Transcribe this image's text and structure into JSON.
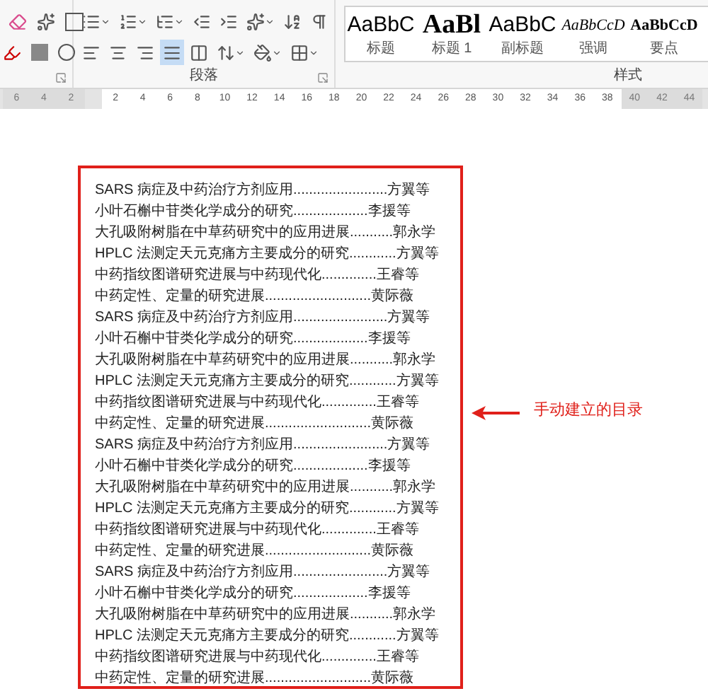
{
  "ribbon": {
    "groups": [
      {
        "kind": "font"
      },
      {
        "kind": "paragraph",
        "label": "段落"
      },
      {
        "kind": "styles",
        "label": "样式"
      }
    ],
    "paragraph_tools": {
      "justify_selected": true
    },
    "styles": [
      {
        "preview": "AaBbC",
        "name": "标题",
        "kind": "sans"
      },
      {
        "preview": "AaBl",
        "name": "标题 1",
        "kind": "heading"
      },
      {
        "preview": "AaBbC",
        "name": "副标题",
        "kind": "sans"
      },
      {
        "preview": "AaBbCcD",
        "name": "强调",
        "kind": "italic"
      },
      {
        "preview": "AaBbCcD",
        "name": "要点",
        "kind": "bold"
      }
    ]
  },
  "ruler": [
    {
      "label": "6",
      "margin": true
    },
    {
      "label": "4",
      "margin": true
    },
    {
      "label": "2",
      "margin": true
    },
    {
      "label": "2",
      "margin": false
    },
    {
      "label": "4",
      "margin": false
    },
    {
      "label": "6",
      "margin": false
    },
    {
      "label": "8",
      "margin": false
    },
    {
      "label": "10",
      "margin": false
    },
    {
      "label": "12",
      "margin": false
    },
    {
      "label": "14",
      "margin": false
    },
    {
      "label": "16",
      "margin": false
    },
    {
      "label": "18",
      "margin": false
    },
    {
      "label": "20",
      "margin": false
    },
    {
      "label": "22",
      "margin": false
    },
    {
      "label": "24",
      "margin": false
    },
    {
      "label": "26",
      "margin": false
    },
    {
      "label": "28",
      "margin": false
    },
    {
      "label": "30",
      "margin": false
    },
    {
      "label": "32",
      "margin": false
    },
    {
      "label": "34",
      "margin": false
    },
    {
      "label": "36",
      "margin": false
    },
    {
      "label": "38",
      "margin": false
    },
    {
      "label": "40",
      "margin": true
    },
    {
      "label": "42",
      "margin": true
    },
    {
      "label": "44",
      "margin": true
    }
  ],
  "toc": [
    {
      "title": "SARS 病症及中药治疗方剂应用",
      "leader": "........................",
      "author": "方翼等"
    },
    {
      "title": "小叶石槲中苷类化学成分的研究",
      "leader": "...................",
      "author": "李援等"
    },
    {
      "title": "大孔吸附树脂在中草药研究中的应用进展",
      "leader": "...........",
      "author": "郭永学"
    },
    {
      "title": "HPLC 法测定天元克痛方主要成分的研究",
      "leader": "............",
      "author": "方翼等"
    },
    {
      "title": "中药指纹图谱研究进展与中药现代化",
      "leader": "..............",
      "author": "王睿等"
    },
    {
      "title": "中药定性、定量的研究进展",
      "leader": "...........................",
      "author": "黄际薇"
    },
    {
      "title": "SARS 病症及中药治疗方剂应用",
      "leader": "........................",
      "author": "方翼等"
    },
    {
      "title": "小叶石槲中苷类化学成分的研究",
      "leader": "...................",
      "author": "李援等"
    },
    {
      "title": "大孔吸附树脂在中草药研究中的应用进展",
      "leader": "...........",
      "author": "郭永学"
    },
    {
      "title": "HPLC 法测定天元克痛方主要成分的研究",
      "leader": "............",
      "author": "方翼等"
    },
    {
      "title": "中药指纹图谱研究进展与中药现代化",
      "leader": "..............",
      "author": "王睿等"
    },
    {
      "title": "中药定性、定量的研究进展",
      "leader": "...........................",
      "author": "黄际薇"
    },
    {
      "title": "SARS 病症及中药治疗方剂应用",
      "leader": "........................",
      "author": "方翼等"
    },
    {
      "title": "小叶石槲中苷类化学成分的研究",
      "leader": "...................",
      "author": "李援等"
    },
    {
      "title": "大孔吸附树脂在中草药研究中的应用进展",
      "leader": "...........",
      "author": "郭永学"
    },
    {
      "title": "HPLC 法测定天元克痛方主要成分的研究",
      "leader": "............",
      "author": "方翼等"
    },
    {
      "title": "中药指纹图谱研究进展与中药现代化",
      "leader": "..............",
      "author": "王睿等"
    },
    {
      "title": "中药定性、定量的研究进展",
      "leader": "...........................",
      "author": "黄际薇"
    },
    {
      "title": "SARS 病症及中药治疗方剂应用",
      "leader": "........................",
      "author": "方翼等"
    },
    {
      "title": "小叶石槲中苷类化学成分的研究",
      "leader": "...................",
      "author": "李援等"
    },
    {
      "title": "大孔吸附树脂在中草药研究中的应用进展",
      "leader": "...........",
      "author": "郭永学"
    },
    {
      "title": "HPLC 法测定天元克痛方主要成分的研究",
      "leader": "............",
      "author": "方翼等"
    },
    {
      "title": "中药指纹图谱研究进展与中药现代化",
      "leader": "..............",
      "author": "王睿等"
    },
    {
      "title": "中药定性、定量的研究进展",
      "leader": "...........................",
      "author": "黄际薇"
    }
  ],
  "annotation": {
    "text": "手动建立的目录"
  }
}
